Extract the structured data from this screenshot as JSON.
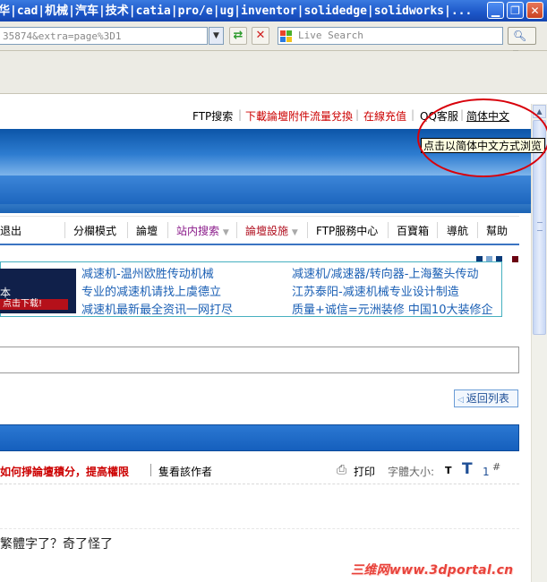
{
  "window": {
    "title": "华|cad|机械|汽车|技术|catia|pro/e|ug|inventor|solidedge|solidworks|..."
  },
  "address_bar": {
    "url": "35874&extra=page%3D1",
    "search_placeholder": "Live Search"
  },
  "top_links": {
    "ftp_search": "FTP搜索",
    "download_exchange": "下載論壇附件流量兌換",
    "recharge": "在線充值",
    "qq_service": "QQ客服",
    "simplified": "简体中文"
  },
  "tooltip": {
    "text": "点击以简体中文方式浏览"
  },
  "nav": {
    "partial": "退出",
    "items": [
      {
        "label": "分欄模式",
        "color": "#000000",
        "caret": false
      },
      {
        "label": "論壇",
        "color": "#000000",
        "caret": false
      },
      {
        "label": "站内搜索",
        "color": "#8a1a8a",
        "caret": true
      },
      {
        "label": "論壇設施",
        "color": "#b01020",
        "caret": true
      },
      {
        "label": "FTP服務中心",
        "color": "#000000",
        "caret": false
      },
      {
        "label": "百寶箱",
        "color": "#000000",
        "caret": false
      },
      {
        "label": "導航",
        "color": "#000000",
        "caret": false
      },
      {
        "label": "幫助",
        "color": "#000000",
        "caret": false
      }
    ]
  },
  "ads": {
    "image_text": "本",
    "image_button": "点击下载!",
    "col1": [
      "减速机-温州欧胜传动机械",
      "专业的减速机请找上虞德立",
      "减速机最新最全资讯一网打尽"
    ],
    "col2": [
      "减速机/减速器/转向器-上海鳌头传动",
      "江苏泰阳-减速机械专业设计制造",
      "质量+诚信=元洲装修  中国10大装修企"
    ],
    "square_colors": [
      "#0a3a7a",
      "#7fa9d4",
      "#0a3a7a",
      "#6b0012"
    ]
  },
  "thread": {
    "back_to_list": "返回列表",
    "warn_link": "如何掙論壇積分，提高權限",
    "view_author": "隻看該作者",
    "print": "打印",
    "font_size_label": "字體大小:",
    "font_small": "T",
    "font_large": "T",
    "floor": "1",
    "floor_mark": "#",
    "post_text": "繁體字了？奇了怪了"
  },
  "watermark": {
    "text": "三维网www.3dportal.cn"
  },
  "colors": {
    "title_blue": "#1c56c8",
    "banner_blue": "#2d7cd0",
    "link_blue": "#1a5fb4",
    "warn_red": "#cc0000",
    "annotation_red": "#d8000a"
  }
}
